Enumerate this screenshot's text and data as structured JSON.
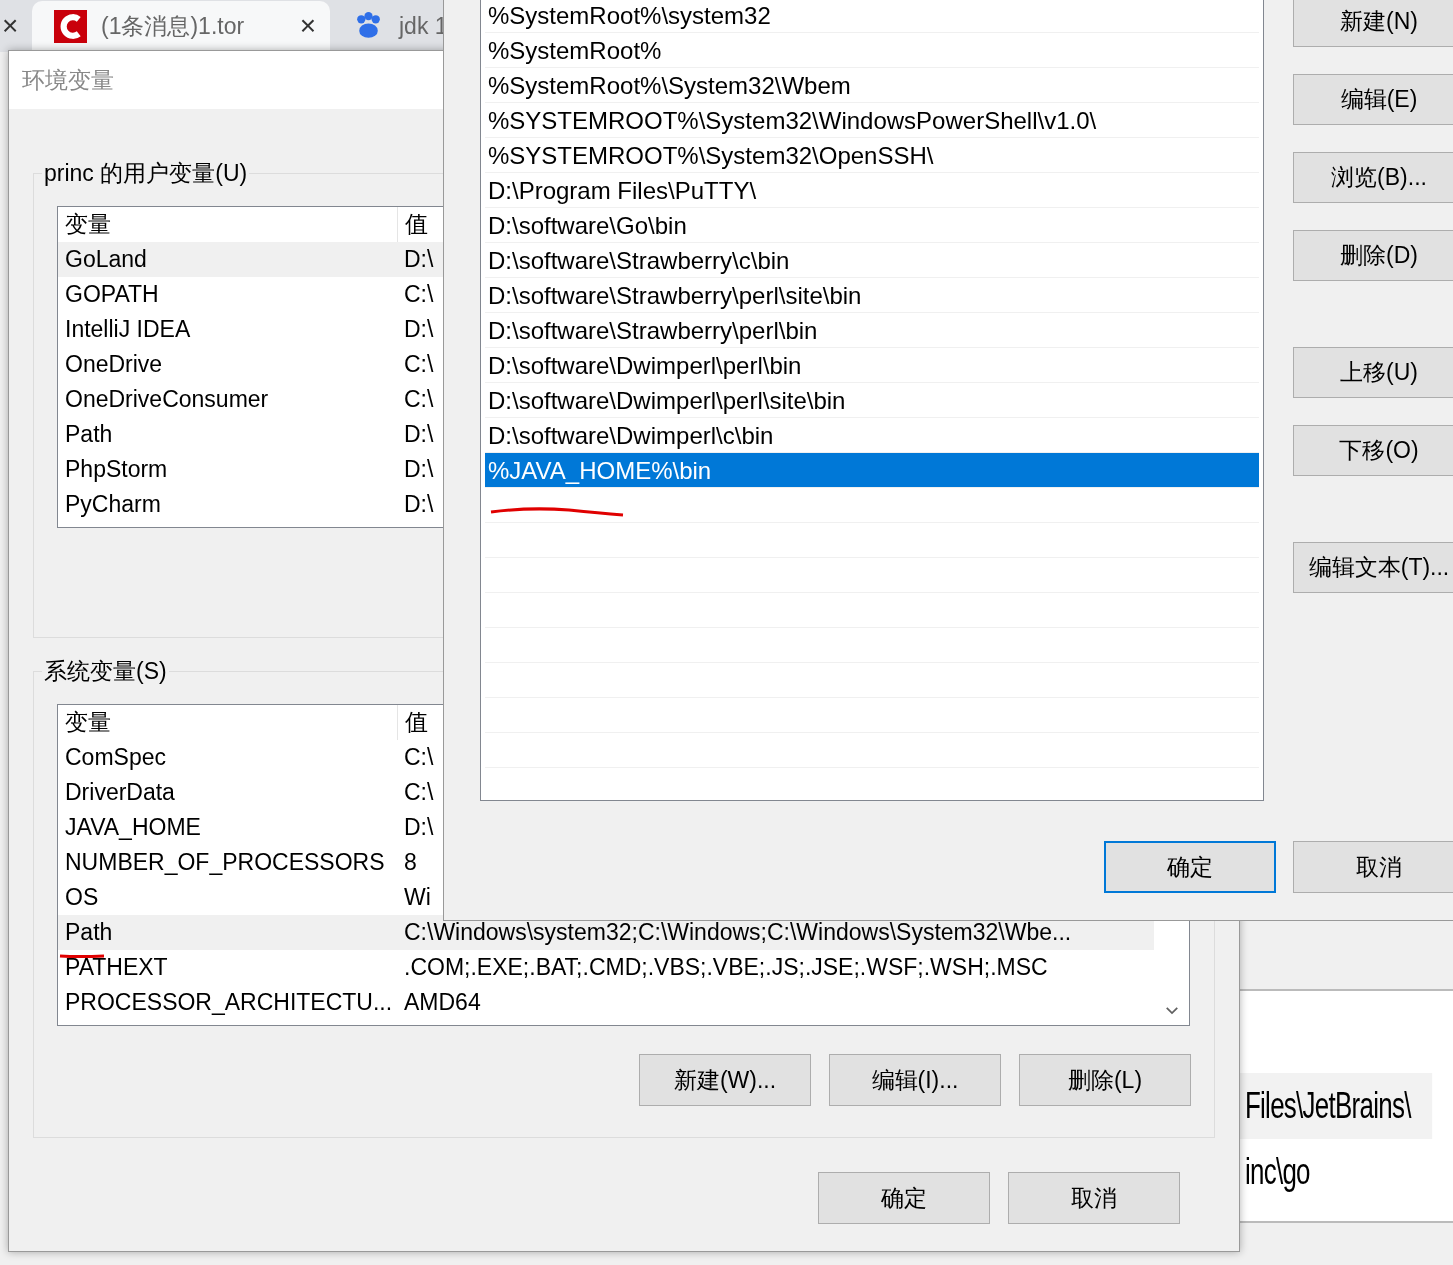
{
  "browser_tabs": [
    {
      "close": "×",
      "selected": false
    },
    {
      "title": "(1条消息)1.tor",
      "close": "×",
      "selected": true
    },
    {
      "title": "jdk 1",
      "selected": false
    }
  ],
  "env_window": {
    "title": "环境变量",
    "user_vars": {
      "legend": "princ 的用户变量(U)",
      "columns": [
        "变量",
        "值"
      ],
      "rows": [
        {
          "name": "GoLand",
          "value": "D:\\",
          "selected": true
        },
        {
          "name": "GOPATH",
          "value": "C:\\",
          "selected": false
        },
        {
          "name": "IntelliJ IDEA",
          "value": "D:\\",
          "selected": false
        },
        {
          "name": "OneDrive",
          "value": "C:\\",
          "selected": false
        },
        {
          "name": "OneDriveConsumer",
          "value": "C:\\",
          "selected": false
        },
        {
          "name": "Path",
          "value": "D:\\",
          "selected": false
        },
        {
          "name": "PhpStorm",
          "value": "D:\\",
          "selected": false
        },
        {
          "name": "PyCharm",
          "value": "D:\\",
          "selected": false
        }
      ]
    },
    "system_vars": {
      "legend": "系统变量(S)",
      "columns": [
        "变量",
        "值"
      ],
      "rows": [
        {
          "name": "ComSpec",
          "value": "C:\\",
          "selected": false
        },
        {
          "name": "DriverData",
          "value": "C:\\",
          "selected": false
        },
        {
          "name": "JAVA_HOME",
          "value": "D:\\",
          "selected": false
        },
        {
          "name": "NUMBER_OF_PROCESSORS",
          "value": "8",
          "selected": false
        },
        {
          "name": "OS",
          "value": "Wi",
          "selected": false
        },
        {
          "name": "Path",
          "value": "C:\\Windows\\system32;C:\\Windows;C:\\Windows\\System32\\Wbe...",
          "selected": true
        },
        {
          "name": "PATHEXT",
          "value": ".COM;.EXE;.BAT;.CMD;.VBS;.VBE;.JS;.JSE;.WSF;.WSH;.MSC",
          "selected": false
        },
        {
          "name": "PROCESSOR_ARCHITECTU...",
          "value": "AMD64",
          "selected": false
        }
      ],
      "buttons": [
        "新建(W)...",
        "编辑(I)...",
        "删除(L)"
      ]
    },
    "buttons": [
      "确定",
      "取消"
    ]
  },
  "edit_dialog": {
    "paths": [
      {
        "text": "%SystemRoot%\\system32",
        "selected": false
      },
      {
        "text": "%SystemRoot%",
        "selected": false
      },
      {
        "text": "%SystemRoot%\\System32\\Wbem",
        "selected": false
      },
      {
        "text": "%SYSTEMROOT%\\System32\\WindowsPowerShell\\v1.0\\",
        "selected": false
      },
      {
        "text": "%SYSTEMROOT%\\System32\\OpenSSH\\",
        "selected": false
      },
      {
        "text": "D:\\Program Files\\PuTTY\\",
        "selected": false
      },
      {
        "text": "D:\\software\\Go\\bin",
        "selected": false
      },
      {
        "text": "D:\\software\\Strawberry\\c\\bin",
        "selected": false
      },
      {
        "text": "D:\\software\\Strawberry\\perl\\site\\bin",
        "selected": false
      },
      {
        "text": "D:\\software\\Strawberry\\perl\\bin",
        "selected": false
      },
      {
        "text": "D:\\software\\Dwimperl\\perl\\bin",
        "selected": false
      },
      {
        "text": "D:\\software\\Dwimperl\\perl\\site\\bin",
        "selected": false
      },
      {
        "text": "D:\\software\\Dwimperl\\c\\bin",
        "selected": false
      },
      {
        "text": "%JAVA_HOME%\\bin",
        "selected": true
      }
    ],
    "side_buttons": [
      "新建(N)",
      "编辑(E)",
      "浏览(B)...",
      "删除(D)",
      "上移(U)",
      "下移(O)",
      "编辑文本(T)..."
    ],
    "buttons": [
      {
        "label": "确定",
        "default": true
      },
      {
        "label": "取消",
        "default": false
      }
    ]
  },
  "background_list": {
    "rows": [
      "Files\\JetBrains\\",
      "inc\\go"
    ]
  }
}
